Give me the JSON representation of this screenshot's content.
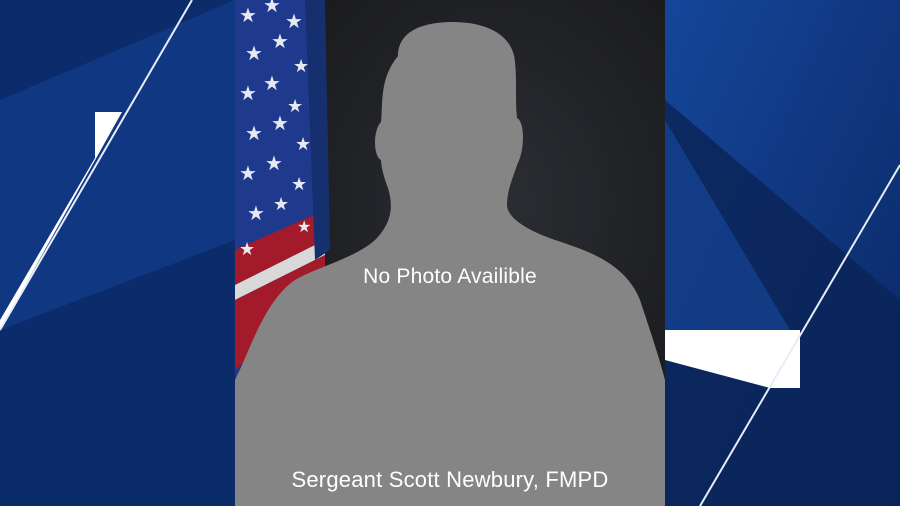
{
  "placeholder_text": "No Photo Availible",
  "caption": "Sergeant Scott Newbury, FMPD",
  "colors": {
    "background_navy": "#0b2a68",
    "background_blue": "#174a9e",
    "silhouette_gray": "#858585",
    "flag_blue": "#1f3a8c",
    "flag_red": "#a31a2a",
    "text_white": "#ffffff"
  },
  "icons": [
    "silhouette-icon",
    "american-flag-icon",
    "star-icon"
  ]
}
